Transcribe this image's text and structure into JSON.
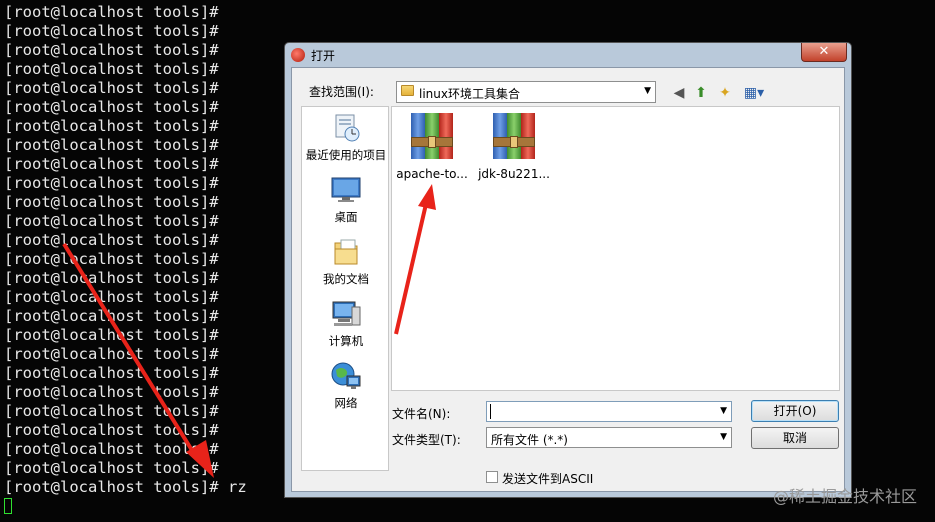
{
  "terminal": {
    "prompt": "[root@localhost tools]#",
    "prompt_line_count": 25,
    "last_command": "rz",
    "text_color": "#e8e8e8",
    "cursor_color": "#2fe02f"
  },
  "dialog": {
    "title": "打开",
    "close_glyph": "✕",
    "look_in_label": "查找范围(I):",
    "look_in_value": "linux环境工具集合",
    "places": [
      {
        "label": "最近使用的项目",
        "icon": "recent-items-icon"
      },
      {
        "label": "桌面",
        "icon": "desktop-icon"
      },
      {
        "label": "我的文档",
        "icon": "my-documents-icon"
      },
      {
        "label": "计算机",
        "icon": "computer-icon"
      },
      {
        "label": "网络",
        "icon": "network-icon"
      }
    ],
    "files": [
      {
        "name": "apache-to...",
        "icon": "winrar-archive-icon"
      },
      {
        "name": "jdk-8u221...",
        "icon": "winrar-archive-icon"
      }
    ],
    "filename_label": "文件名(N):",
    "filename_value": "",
    "filetype_label": "文件类型(T):",
    "filetype_value": "所有文件 (*.*)",
    "open_button": "打开(O)",
    "cancel_button": "取消",
    "ascii_checkbox_label": "发送文件到ASCII",
    "ascii_checked": false
  },
  "watermark": "@稀土掘金技术社区",
  "annotation_color": "#e8231a"
}
